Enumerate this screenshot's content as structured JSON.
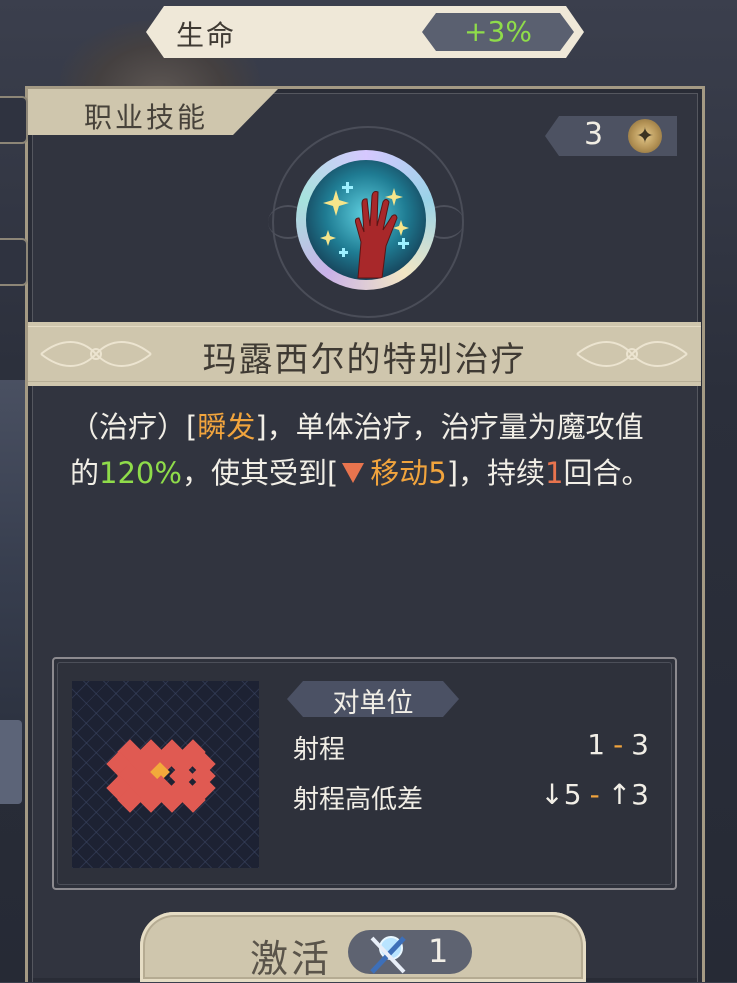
{
  "status": {
    "label": "生命",
    "value": "+3%"
  },
  "panel": {
    "tab_title": "职业技能",
    "cost": "3"
  },
  "skill": {
    "name": "玛露西尔的特别治疗",
    "description": {
      "p1": "（治疗）[",
      "instant": "瞬发",
      "p2": "]，单体治疗，治疗量为魔攻值的",
      "percent": "120%",
      "p3": "，使其受到[",
      "debuff": "移动5",
      "p4": "]，持续",
      "turns": "1",
      "p5": "回合。"
    }
  },
  "range_info": {
    "target_type": "对单位",
    "range_label": "射程",
    "range_min": "1",
    "range_sep": "-",
    "range_max": "3",
    "height_label": "射程高低差",
    "height_down": "↓5",
    "height_sep": "-",
    "height_up": "↑3"
  },
  "activate": {
    "label": "激活",
    "count": "1"
  },
  "colors": {
    "highlight_orange": "#f1a43d",
    "highlight_green": "#8fdc4a",
    "highlight_red": "#e8744e",
    "tile_red": "#e05a52",
    "tile_center": "#f2a93b"
  },
  "icons": {
    "cost": "star-coin-icon",
    "skill": "healing-hand-icon",
    "debuff": "down-triangle-icon",
    "activate": "crystal-sword-icon"
  }
}
